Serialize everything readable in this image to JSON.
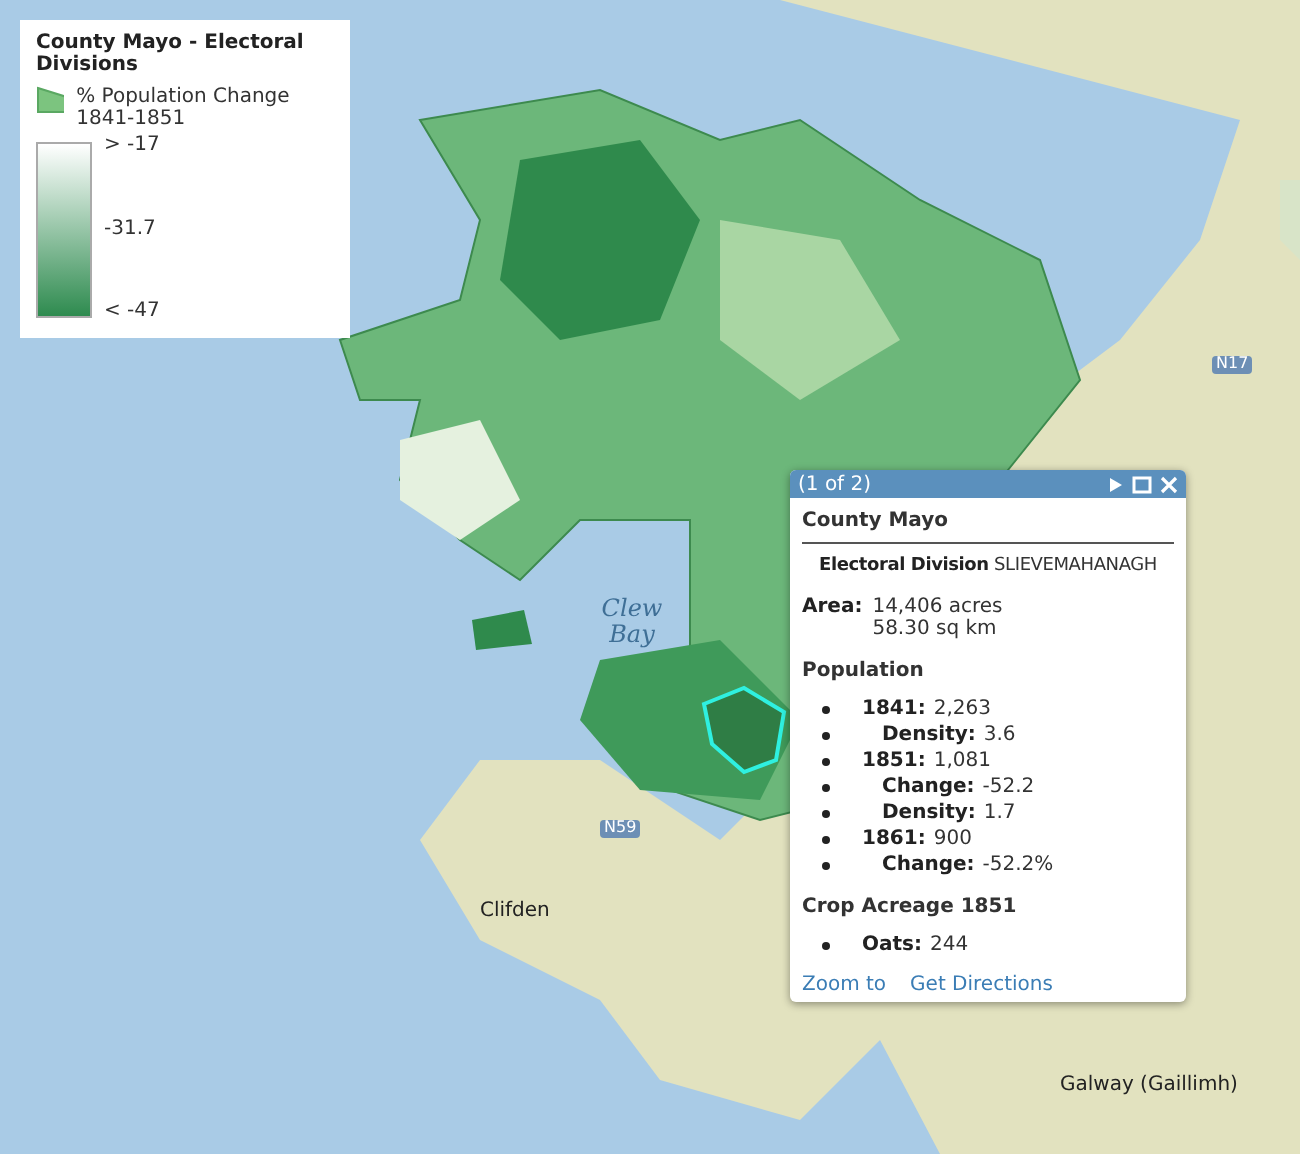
{
  "legend": {
    "title": "County Mayo - Electoral Divisions",
    "layer": "% Population Change 1841-1851",
    "ramp": [
      "> -17",
      "-31.7",
      "< -47"
    ]
  },
  "map_labels": [
    {
      "text": "Clew Bay",
      "kind": "water"
    },
    {
      "text": "Clifden",
      "kind": "town"
    },
    {
      "text": "Galway (Gaillimh)",
      "kind": "town"
    },
    {
      "text": "N59",
      "kind": "road"
    },
    {
      "text": "N17",
      "kind": "road"
    }
  ],
  "popup": {
    "counter": "(1 of 2)",
    "title": "County Mayo",
    "division_label": "Electoral Division",
    "division_value": "SLIEVEMAHANAGH",
    "area_label": "Area:",
    "area_values": [
      "14,406 acres",
      "58.30 sq km"
    ],
    "population_heading": "Population",
    "population": [
      {
        "label": "1841:",
        "value": "2,263",
        "kind": "year"
      },
      {
        "label": "Density:",
        "value": "3.6",
        "kind": "sub"
      },
      {
        "label": "1851:",
        "value": "1,081",
        "kind": "year"
      },
      {
        "label": "Change:",
        "value": "-52.2",
        "kind": "sub"
      },
      {
        "label": "Density:",
        "value": "1.7",
        "kind": "sub"
      },
      {
        "label": "1861:",
        "value": "900",
        "kind": "year"
      },
      {
        "label": "Change:",
        "value": "-52.2%",
        "kind": "sub"
      }
    ],
    "crop_heading": "Crop Acreage 1851",
    "crops": [
      {
        "label": "Oats:",
        "value": "244"
      }
    ],
    "links": [
      "Zoom to",
      "Get Directions"
    ]
  }
}
